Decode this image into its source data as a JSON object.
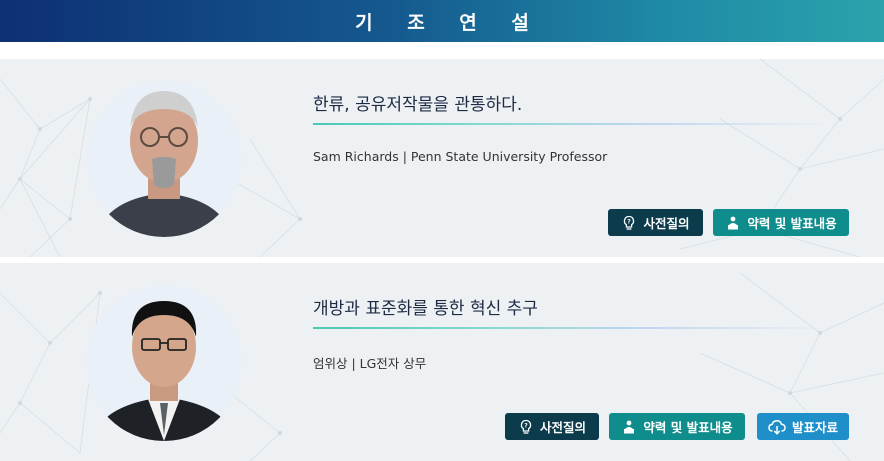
{
  "header": {
    "title": "기 조 연 설"
  },
  "speakers": [
    {
      "title": "한류, 공유저작물을 관통하다.",
      "speaker": "Sam Richards | Penn State University Professor",
      "buttons": {
        "question": "사전질의",
        "profile": "약력 및 발표내용"
      }
    },
    {
      "title": "개방과 표준화를 통한 혁신 추구",
      "speaker": "엄위상 | LG전자 상무",
      "buttons": {
        "question": "사전질의",
        "profile": "약력 및 발표내용",
        "download": "발표자료"
      }
    }
  ],
  "colors": {
    "header_start": "#0d2f73",
    "header_end": "#2aa3ac",
    "btn_dark": "#0c3b4b",
    "btn_teal": "#0f8c8c",
    "btn_blue": "#1e8fc8"
  },
  "icons": {
    "question": "lightbulb-question-icon",
    "profile": "podium-speaker-icon",
    "download": "cloud-download-icon"
  }
}
